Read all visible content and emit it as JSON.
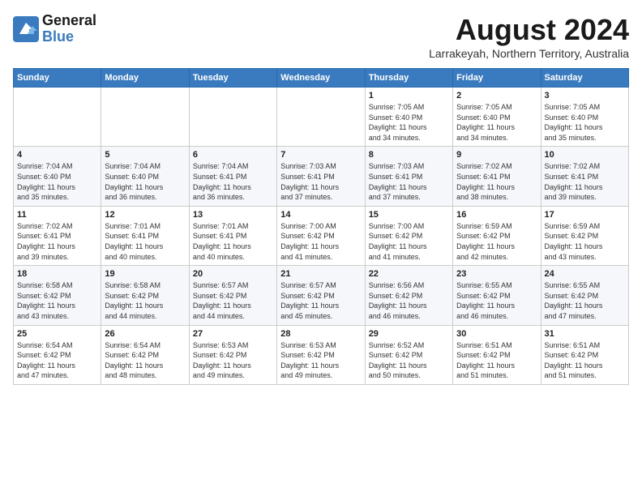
{
  "logo": {
    "line1": "General",
    "line2": "Blue"
  },
  "title": {
    "month_year": "August 2024",
    "location": "Larrakeyah, Northern Territory, Australia"
  },
  "days_of_week": [
    "Sunday",
    "Monday",
    "Tuesday",
    "Wednesday",
    "Thursday",
    "Friday",
    "Saturday"
  ],
  "weeks": [
    [
      {
        "day": "",
        "info": ""
      },
      {
        "day": "",
        "info": ""
      },
      {
        "day": "",
        "info": ""
      },
      {
        "day": "",
        "info": ""
      },
      {
        "day": "1",
        "info": "Sunrise: 7:05 AM\nSunset: 6:40 PM\nDaylight: 11 hours\nand 34 minutes."
      },
      {
        "day": "2",
        "info": "Sunrise: 7:05 AM\nSunset: 6:40 PM\nDaylight: 11 hours\nand 34 minutes."
      },
      {
        "day": "3",
        "info": "Sunrise: 7:05 AM\nSunset: 6:40 PM\nDaylight: 11 hours\nand 35 minutes."
      }
    ],
    [
      {
        "day": "4",
        "info": "Sunrise: 7:04 AM\nSunset: 6:40 PM\nDaylight: 11 hours\nand 35 minutes."
      },
      {
        "day": "5",
        "info": "Sunrise: 7:04 AM\nSunset: 6:40 PM\nDaylight: 11 hours\nand 36 minutes."
      },
      {
        "day": "6",
        "info": "Sunrise: 7:04 AM\nSunset: 6:41 PM\nDaylight: 11 hours\nand 36 minutes."
      },
      {
        "day": "7",
        "info": "Sunrise: 7:03 AM\nSunset: 6:41 PM\nDaylight: 11 hours\nand 37 minutes."
      },
      {
        "day": "8",
        "info": "Sunrise: 7:03 AM\nSunset: 6:41 PM\nDaylight: 11 hours\nand 37 minutes."
      },
      {
        "day": "9",
        "info": "Sunrise: 7:02 AM\nSunset: 6:41 PM\nDaylight: 11 hours\nand 38 minutes."
      },
      {
        "day": "10",
        "info": "Sunrise: 7:02 AM\nSunset: 6:41 PM\nDaylight: 11 hours\nand 39 minutes."
      }
    ],
    [
      {
        "day": "11",
        "info": "Sunrise: 7:02 AM\nSunset: 6:41 PM\nDaylight: 11 hours\nand 39 minutes."
      },
      {
        "day": "12",
        "info": "Sunrise: 7:01 AM\nSunset: 6:41 PM\nDaylight: 11 hours\nand 40 minutes."
      },
      {
        "day": "13",
        "info": "Sunrise: 7:01 AM\nSunset: 6:41 PM\nDaylight: 11 hours\nand 40 minutes."
      },
      {
        "day": "14",
        "info": "Sunrise: 7:00 AM\nSunset: 6:42 PM\nDaylight: 11 hours\nand 41 minutes."
      },
      {
        "day": "15",
        "info": "Sunrise: 7:00 AM\nSunset: 6:42 PM\nDaylight: 11 hours\nand 41 minutes."
      },
      {
        "day": "16",
        "info": "Sunrise: 6:59 AM\nSunset: 6:42 PM\nDaylight: 11 hours\nand 42 minutes."
      },
      {
        "day": "17",
        "info": "Sunrise: 6:59 AM\nSunset: 6:42 PM\nDaylight: 11 hours\nand 43 minutes."
      }
    ],
    [
      {
        "day": "18",
        "info": "Sunrise: 6:58 AM\nSunset: 6:42 PM\nDaylight: 11 hours\nand 43 minutes."
      },
      {
        "day": "19",
        "info": "Sunrise: 6:58 AM\nSunset: 6:42 PM\nDaylight: 11 hours\nand 44 minutes."
      },
      {
        "day": "20",
        "info": "Sunrise: 6:57 AM\nSunset: 6:42 PM\nDaylight: 11 hours\nand 44 minutes."
      },
      {
        "day": "21",
        "info": "Sunrise: 6:57 AM\nSunset: 6:42 PM\nDaylight: 11 hours\nand 45 minutes."
      },
      {
        "day": "22",
        "info": "Sunrise: 6:56 AM\nSunset: 6:42 PM\nDaylight: 11 hours\nand 46 minutes."
      },
      {
        "day": "23",
        "info": "Sunrise: 6:55 AM\nSunset: 6:42 PM\nDaylight: 11 hours\nand 46 minutes."
      },
      {
        "day": "24",
        "info": "Sunrise: 6:55 AM\nSunset: 6:42 PM\nDaylight: 11 hours\nand 47 minutes."
      }
    ],
    [
      {
        "day": "25",
        "info": "Sunrise: 6:54 AM\nSunset: 6:42 PM\nDaylight: 11 hours\nand 47 minutes."
      },
      {
        "day": "26",
        "info": "Sunrise: 6:54 AM\nSunset: 6:42 PM\nDaylight: 11 hours\nand 48 minutes."
      },
      {
        "day": "27",
        "info": "Sunrise: 6:53 AM\nSunset: 6:42 PM\nDaylight: 11 hours\nand 49 minutes."
      },
      {
        "day": "28",
        "info": "Sunrise: 6:53 AM\nSunset: 6:42 PM\nDaylight: 11 hours\nand 49 minutes."
      },
      {
        "day": "29",
        "info": "Sunrise: 6:52 AM\nSunset: 6:42 PM\nDaylight: 11 hours\nand 50 minutes."
      },
      {
        "day": "30",
        "info": "Sunrise: 6:51 AM\nSunset: 6:42 PM\nDaylight: 11 hours\nand 51 minutes."
      },
      {
        "day": "31",
        "info": "Sunrise: 6:51 AM\nSunset: 6:42 PM\nDaylight: 11 hours\nand 51 minutes."
      }
    ]
  ]
}
